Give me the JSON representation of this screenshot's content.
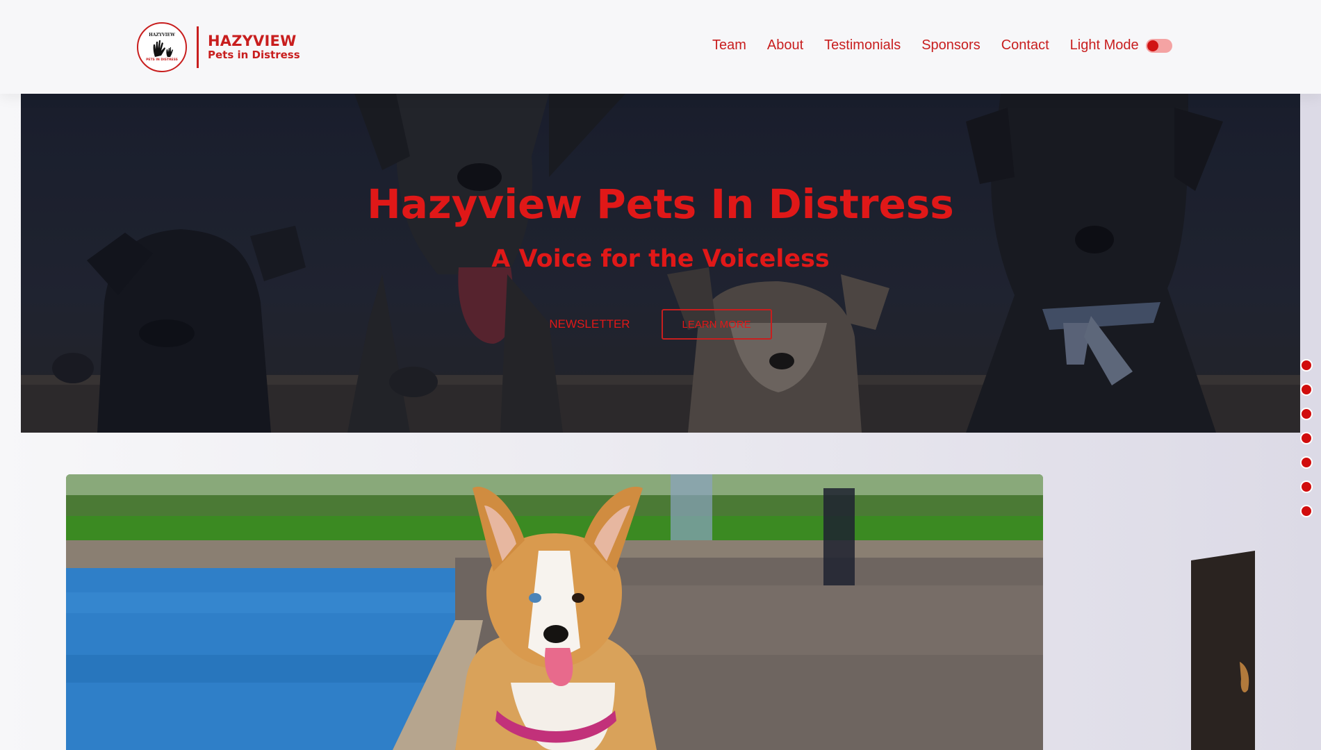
{
  "brand": {
    "logo_top": "HAZYVIEW",
    "logo_bottom": "PETS IN DISTRESS",
    "name": "HAZYVIEW",
    "tagline": "Pets in Distress"
  },
  "nav": {
    "items": [
      {
        "label": "Team"
      },
      {
        "label": "About"
      },
      {
        "label": "Testimonials"
      },
      {
        "label": "Sponsors"
      },
      {
        "label": "Contact"
      }
    ],
    "mode_label": "Light Mode",
    "mode_toggle_on": false
  },
  "hero": {
    "title": "Hazyview Pets In Distress",
    "subtitle": "A Voice for the Voiceless",
    "newsletter_label": "NEWSLETTER",
    "learn_more_label": "LEARN MORE"
  },
  "section_dots": {
    "count": 7
  },
  "colors": {
    "accent": "#c81e1e",
    "accent_bright": "#e01818",
    "dot": "#d10d0d",
    "header_bg": "#f7f7f9"
  },
  "icons": [
    "hand-print-icon",
    "toggle-icon",
    "section-dot-icon"
  ]
}
